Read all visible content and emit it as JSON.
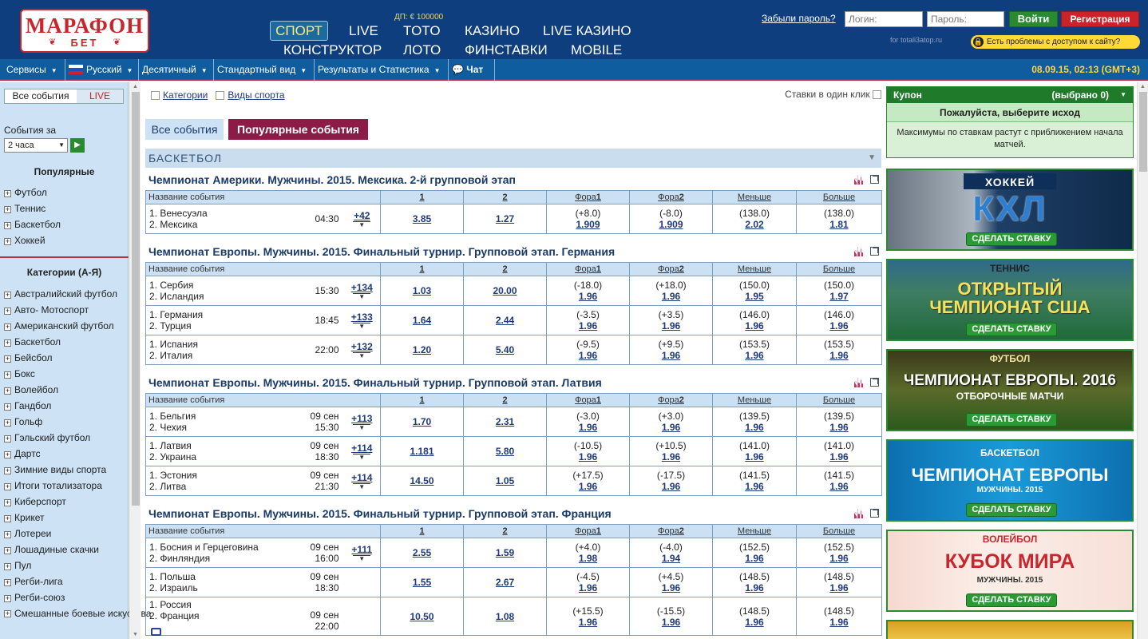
{
  "header": {
    "logo_line1": "МАРАФОН",
    "logo_line2": "БЕТ",
    "jackpot": "ДП: € 100000",
    "nav": [
      "СПОРТ",
      "LIVE",
      "TOTO",
      "КАЗИНО",
      "LIVE КАЗИНО",
      "КОНСТРУКТОР",
      "ЛОТО",
      "ФИНСТАВКИ",
      "MOBILE"
    ],
    "forgot": "Забыли пароль?",
    "login_placeholder": "Логин:",
    "password_placeholder": "Пароль:",
    "login_btn": "Войти",
    "register_btn": "Регистрация",
    "for_site": "for totali3atop.ru",
    "access_problem": "Есть проблемы с доступом к сайту?"
  },
  "menubar": {
    "items": [
      "Сервисы",
      "Русский",
      "Десятичный",
      "Стандартный вид",
      "Результаты и Статистика",
      "Чат"
    ],
    "datetime": "08.09.15, 02:13 (GMT+3)"
  },
  "sidebar": {
    "tab_all": "Все события",
    "tab_live": "LIVE",
    "events_for": "События за",
    "period": "2 часа",
    "popular_title": "Популярные",
    "popular": [
      "Футбол",
      "Теннис",
      "Баскетбол",
      "Хоккей"
    ],
    "categories_title": "Категории (А-Я)",
    "categories": [
      "Австралийский футбол",
      "Авто- Мотоспорт",
      "Американский футбол",
      "Баскетбол",
      "Бейсбол",
      "Бокс",
      "Волейбол",
      "Гандбол",
      "Гольф",
      "Гэльский футбол",
      "Дартс",
      "Зимние виды спорта",
      "Итоги тотализатора",
      "Киберспорт",
      "Крикет",
      "Лотереи",
      "Лошадиные скачки",
      "Пул",
      "Регби-лига",
      "Регби-союз",
      "Смешанные боевые искусства"
    ]
  },
  "content": {
    "opt_categories": "Категории",
    "opt_sports": "Виды спорта",
    "one_click": "Ставки в один клик",
    "tab_all": "Все события",
    "tab_popular": "Популярные события",
    "sport": "БАСКЕТБОЛ",
    "columns": {
      "name": "Название события",
      "c1": "1",
      "c2": "2",
      "fora1": "Фора",
      "fora1n": "1",
      "fora2": "Фора",
      "fora2n": "2",
      "less": "Меньше",
      "more": "Больше"
    },
    "leagues": [
      {
        "title": "Чемпионат Америки. Мужчины. 2015. Мексика. 2-й групповой этап",
        "events": [
          {
            "t1": "Венесуэла",
            "t2": "Мексика",
            "date": "",
            "time": "04:30",
            "count": "+42",
            "o1": "3.85",
            "o2": "1.27",
            "f1h": "(+8.0)",
            "f1": "1.909",
            "f2h": "(-8.0)",
            "f2": "1.909",
            "lh": "(138.0)",
            "l": "2.02",
            "mh": "(138.0)",
            "m": "1.81"
          }
        ]
      },
      {
        "title": "Чемпионат Европы. Мужчины. 2015. Финальный турнир. Групповой этап. Германия",
        "events": [
          {
            "t1": "Сербия",
            "t2": "Исландия",
            "date": "",
            "time": "15:30",
            "count": "+134",
            "o1": "1.03",
            "o2": "20.00",
            "f1h": "(-18.0)",
            "f1": "1.96",
            "f2h": "(+18.0)",
            "f2": "1.96",
            "lh": "(150.0)",
            "l": "1.95",
            "mh": "(150.0)",
            "m": "1.97"
          },
          {
            "t1": "Германия",
            "t2": "Турция",
            "date": "",
            "time": "18:45",
            "count": "+133",
            "o1": "1.64",
            "o2": "2.44",
            "f1h": "(-3.5)",
            "f1": "1.96",
            "f2h": "(+3.5)",
            "f2": "1.96",
            "lh": "(146.0)",
            "l": "1.96",
            "mh": "(146.0)",
            "m": "1.96"
          },
          {
            "t1": "Испания",
            "t2": "Италия",
            "date": "",
            "time": "22:00",
            "count": "+132",
            "o1": "1.20",
            "o2": "5.40",
            "f1h": "(-9.5)",
            "f1": "1.96",
            "f2h": "(+9.5)",
            "f2": "1.96",
            "lh": "(153.5)",
            "l": "1.96",
            "mh": "(153.5)",
            "m": "1.96"
          }
        ]
      },
      {
        "title": "Чемпионат Европы. Мужчины. 2015. Финальный турнир. Групповой этап. Латвия",
        "events": [
          {
            "t1": "Бельгия",
            "t2": "Чехия",
            "date": "09 сен",
            "time": "15:30",
            "count": "+113",
            "o1": "1.70",
            "o2": "2.31",
            "f1h": "(-3.0)",
            "f1": "1.96",
            "f2h": "(+3.0)",
            "f2": "1.96",
            "lh": "(139.5)",
            "l": "1.96",
            "mh": "(139.5)",
            "m": "1.96"
          },
          {
            "t1": "Латвия",
            "t2": "Украина",
            "date": "09 сен",
            "time": "18:30",
            "count": "+114",
            "o1": "1.181",
            "o2": "5.80",
            "f1h": "(-10.5)",
            "f1": "1.96",
            "f2h": "(+10.5)",
            "f2": "1.96",
            "lh": "(141.0)",
            "l": "1.96",
            "mh": "(141.0)",
            "m": "1.96"
          },
          {
            "t1": "Эстония",
            "t2": "Литва",
            "date": "09 сен",
            "time": "21:30",
            "count": "+114",
            "o1": "14.50",
            "o2": "1.05",
            "f1h": "(+17.5)",
            "f1": "1.96",
            "f2h": "(-17.5)",
            "f2": "1.96",
            "lh": "(141.5)",
            "l": "1.96",
            "mh": "(141.5)",
            "m": "1.96"
          }
        ]
      },
      {
        "title": "Чемпионат Европы. Мужчины. 2015. Финальный турнир. Групповой этап. Франция",
        "events": [
          {
            "t1": "Босния и Герцеговина",
            "t2": "Финляндия",
            "date": "09 сен",
            "time": "16:00",
            "count": "+111",
            "o1": "2.55",
            "o2": "1.59",
            "f1h": "(+4.0)",
            "f1": "1.98",
            "f2h": "(-4.0)",
            "f2": "1.94",
            "lh": "(152.5)",
            "l": "1.96",
            "mh": "(152.5)",
            "m": "1.96"
          },
          {
            "t1": "Польша",
            "t2": "Израиль",
            "date": "09 сен",
            "time": "18:30",
            "count": "",
            "o1": "1.55",
            "o2": "2.67",
            "f1h": "(-4.5)",
            "f1": "1.96",
            "f2h": "(+4.5)",
            "f2": "1.96",
            "lh": "(148.5)",
            "l": "1.96",
            "mh": "(148.5)",
            "m": "1.96"
          },
          {
            "t1": "Россия",
            "t2": "Франция",
            "date": "09 сен",
            "time": "22:00",
            "count": "",
            "o1": "10.50",
            "o2": "1.08",
            "f1h": "(+15.5)",
            "f1": "1.96",
            "f2h": "(-15.5)",
            "f2": "1.96",
            "lh": "(148.5)",
            "l": "1.96",
            "mh": "(148.5)",
            "m": "1.96"
          }
        ]
      }
    ]
  },
  "coupon": {
    "title": "Купон",
    "selected": "(выбрано 0)",
    "pick": "Пожалуйста, выберите исход",
    "note": "Максимумы по ставкам растут с приближением начала матчей."
  },
  "banners": [
    {
      "tag": "ХОККЕЙ",
      "big": "КХЛ",
      "sub": "",
      "btn": "СДЕЛАТЬ СТАВКУ"
    },
    {
      "tag": "ТЕННИС",
      "big": "ОТКРЫТЫЙ ЧЕМПИОНАТ США",
      "sub": "",
      "btn": "СДЕЛАТЬ СТАВКУ"
    },
    {
      "tag": "ФУТБОЛ",
      "big": "ЧЕМПИОНАТ ЕВРОПЫ. 2016",
      "sub": "ОТБОРОЧНЫЕ МАТЧИ",
      "btn": "СДЕЛАТЬ СТАВКУ"
    },
    {
      "tag": "БАСКЕТБОЛ",
      "big": "ЧЕМПИОНАТ ЕВРОПЫ",
      "sub": "МУЖЧИНЫ. 2015",
      "btn": "СДЕЛАТЬ СТАВКУ"
    },
    {
      "tag": "ВОЛЕЙБОЛ",
      "big": "КУБОК МИРА",
      "sub": "МУЖЧИНЫ. 2015",
      "btn": "СДЕЛАТЬ СТАВКУ"
    }
  ]
}
